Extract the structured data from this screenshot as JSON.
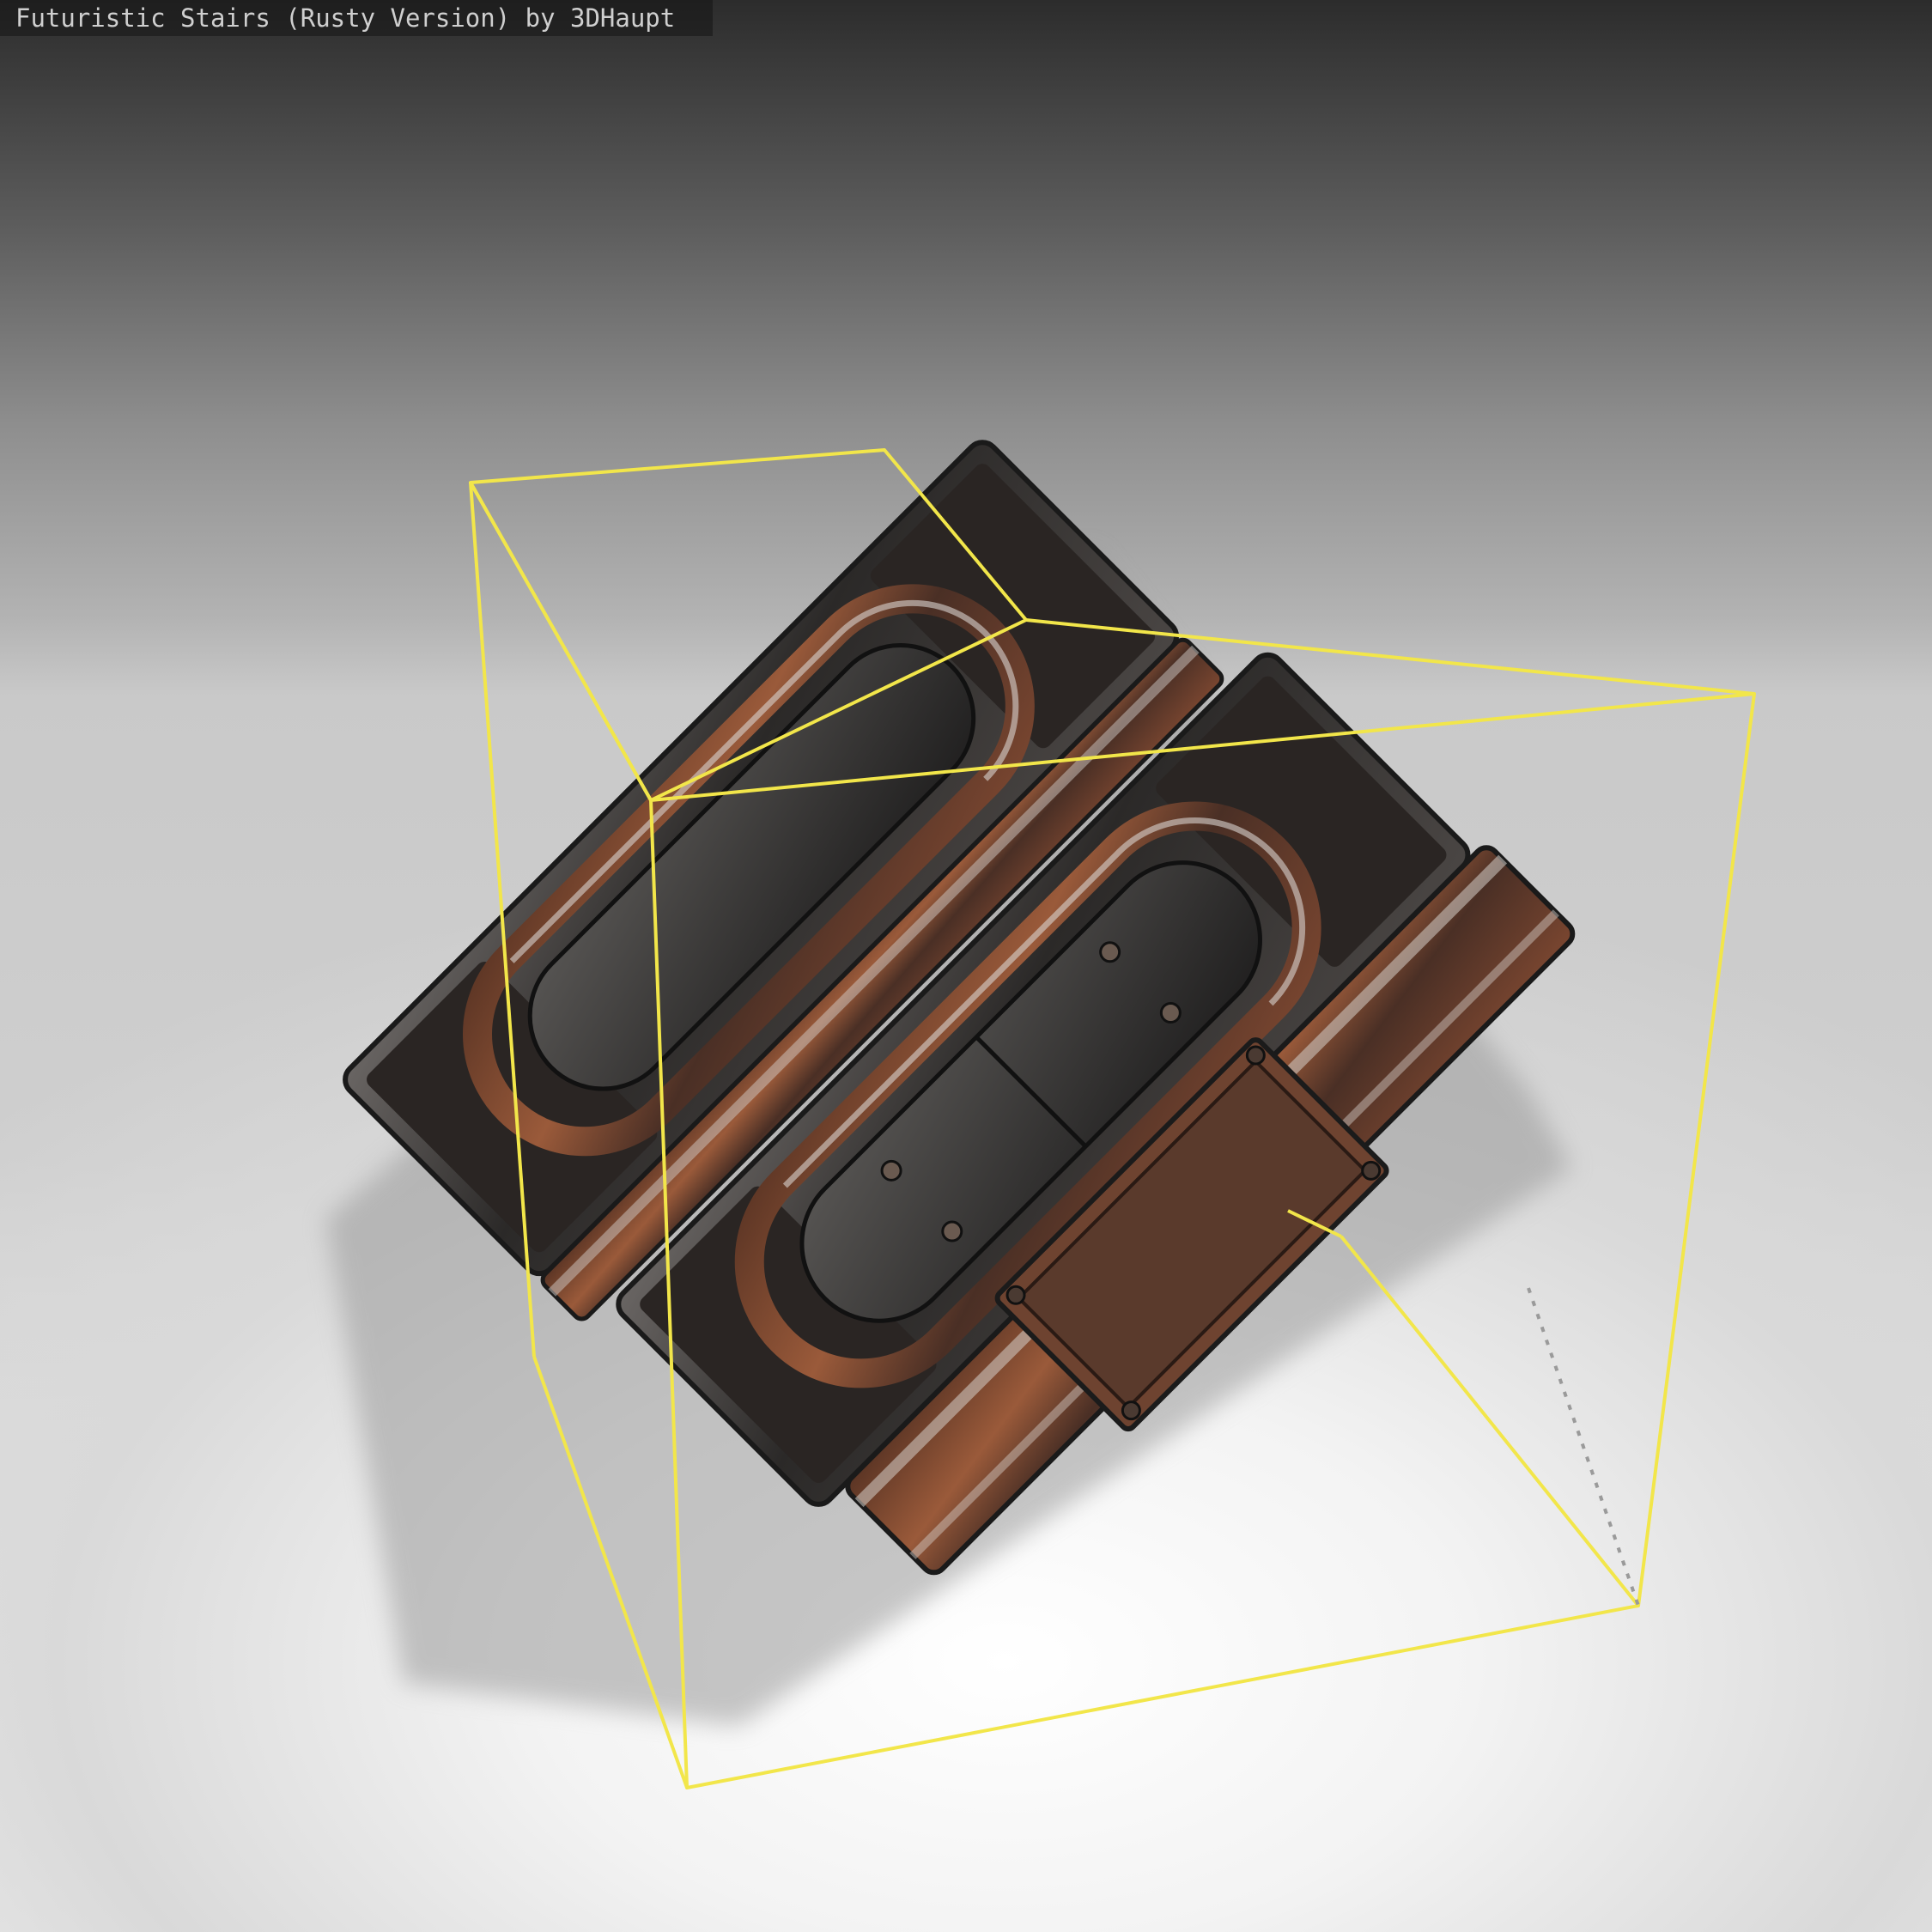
{
  "viewer": {
    "title": "Futuristic Stairs (Rusty Version) by 3DHaupt"
  },
  "scene": {
    "model": "futuristic-stairs-rusty",
    "bounding_box_color": "#f2e64a",
    "rust_color": "#8a4a2c",
    "metal_color": "#3a3735",
    "background_top": "#2c2c2c",
    "background_floor": "#ffffff"
  }
}
